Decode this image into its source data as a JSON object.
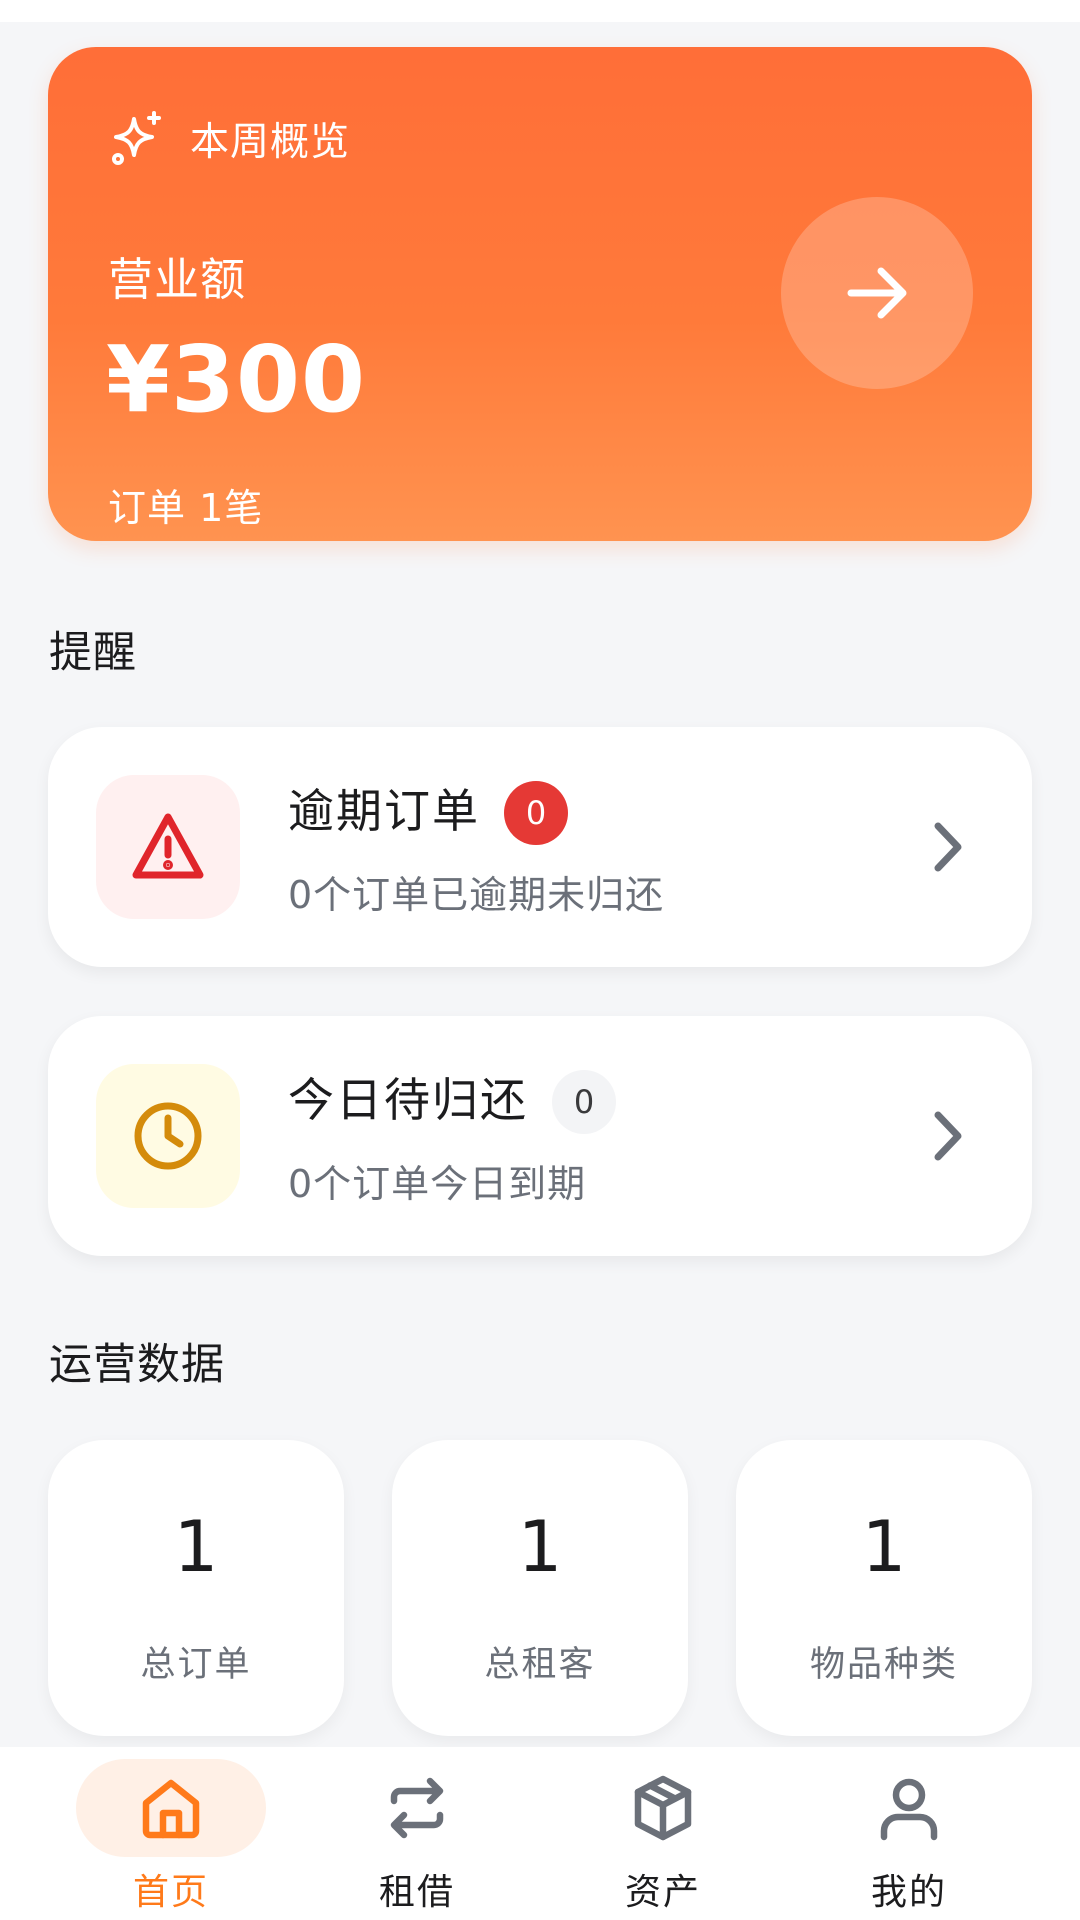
{
  "hero": {
    "heading": "本周概览",
    "label": "营业额",
    "amount": "¥300",
    "orders": "订单 1笔",
    "arrow_icon": "arrow-right-icon"
  },
  "reminders": {
    "title": "提醒",
    "items": [
      {
        "title": "逾期订单",
        "badge": "0",
        "subtitle": "0个订单已逾期未归还",
        "icon": "warning-triangle-icon",
        "icon_color": "#e0252b",
        "icon_bg": "#fff0f0",
        "badge_bg": "#e53935",
        "badge_color": "#ffffff"
      },
      {
        "title": "今日待归还",
        "badge": "0",
        "subtitle": "0个订单今日到期",
        "icon": "clock-icon",
        "icon_color": "#d48b0b",
        "icon_bg": "#fffbe3",
        "badge_bg": "#f3f4f6",
        "badge_color": "#3a3a3c"
      }
    ]
  },
  "stats": {
    "title": "运营数据",
    "items": [
      {
        "value": "1",
        "label": "总订单"
      },
      {
        "value": "1",
        "label": "总租客"
      },
      {
        "value": "1",
        "label": "物品种类"
      }
    ]
  },
  "nav": {
    "active_color": "#ff7a1a",
    "items": [
      {
        "label": "首页",
        "icon": "home-icon",
        "active": true
      },
      {
        "label": "租借",
        "icon": "swap-arrows-icon",
        "active": false
      },
      {
        "label": "资产",
        "icon": "box-icon",
        "active": false
      },
      {
        "label": "我的",
        "icon": "user-icon",
        "active": false
      }
    ]
  }
}
